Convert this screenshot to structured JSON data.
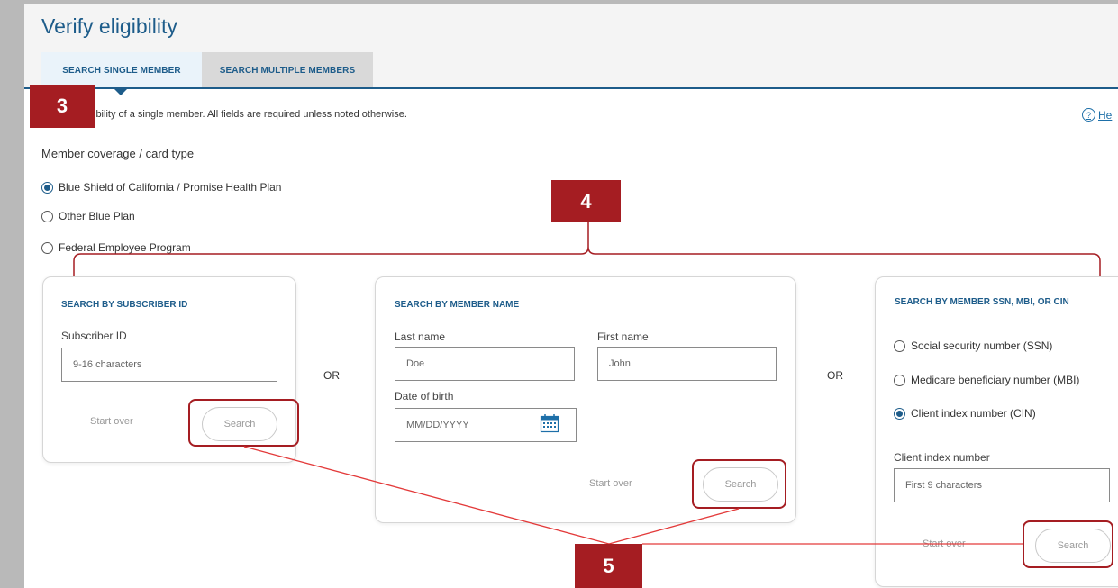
{
  "page": {
    "title": "Verify eligibility",
    "intro": "Verify eligibility of a single member. All fields are required unless noted otherwise.",
    "intro_visible": "ibility of a single member. All fields are required unless noted otherwise.",
    "help_label": "He"
  },
  "tabs": [
    {
      "label": "SEARCH SINGLE MEMBER",
      "active": true
    },
    {
      "label": "SEARCH MULTIPLE MEMBERS",
      "active": false
    }
  ],
  "coverage": {
    "label": "Member coverage / card type",
    "options": [
      {
        "label": "Blue Shield of California / Promise Health Plan",
        "selected": true
      },
      {
        "label": "Other Blue Plan",
        "selected": false
      },
      {
        "label": "Federal Employee Program",
        "selected": false
      }
    ]
  },
  "subscriber_card": {
    "title": "SEARCH BY SUBSCRIBER ID",
    "field_label": "Subscriber ID",
    "placeholder": "9-16 characters",
    "start_over": "Start over",
    "search": "Search"
  },
  "or_label": "OR",
  "name_card": {
    "title": "SEARCH BY MEMBER NAME",
    "last_name_label": "Last name",
    "last_name_placeholder": "Doe",
    "first_name_label": "First name",
    "first_name_placeholder": "John",
    "dob_label": "Date of birth",
    "dob_placeholder": "MM/DD/YYYY",
    "start_over": "Start over",
    "search": "Search"
  },
  "id_card": {
    "title": "SEARCH BY MEMBER SSN, MBI, OR CIN",
    "options": [
      {
        "label": "Social security number (SSN)",
        "selected": false
      },
      {
        "label": "Medicare beneficiary number (MBI)",
        "selected": false
      },
      {
        "label": "Client index number (CIN)",
        "selected": true
      }
    ],
    "field_label": "Client index number",
    "placeholder": "First 9 characters",
    "start_over": "Start over",
    "search": "Search"
  },
  "callouts": [
    "3",
    "4",
    "5"
  ],
  "colors": {
    "brand_blue": "#1d5c8a",
    "callout_red": "#a51d22",
    "header_gray": "#f4f4f4"
  },
  "icons": [
    "calendar-icon",
    "help-icon"
  ]
}
